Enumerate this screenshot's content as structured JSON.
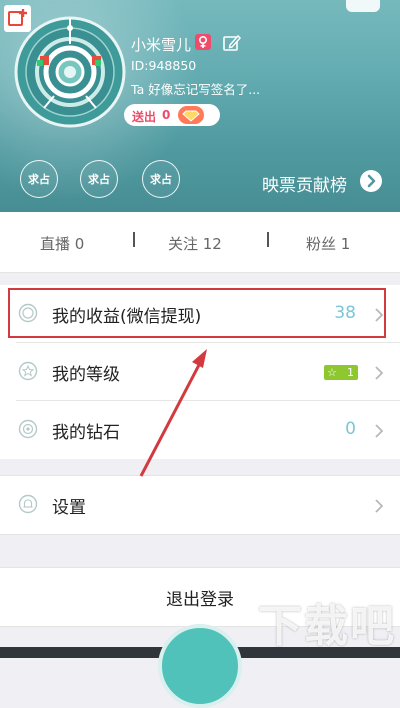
{
  "profile": {
    "username": "小米雪儿",
    "gender_symbol": "♀",
    "id_text": "ID:948850",
    "signature": "Ta 好像忘记写签名了...",
    "sent_label": "送出",
    "sent_count": "0"
  },
  "contrib": {
    "badges": [
      "求占",
      "求占",
      "求占"
    ],
    "label": "映票贡献榜"
  },
  "stats": {
    "live": "直播 0",
    "follow": "关注 12",
    "fans": "粉丝 1"
  },
  "menu": {
    "earnings": {
      "label": "我的收益(微信提现)",
      "value": "38"
    },
    "level": {
      "label": "我的等级",
      "star": "☆",
      "value": "1"
    },
    "diamonds": {
      "label": "我的钻石",
      "value": "0"
    },
    "settings": {
      "label": "设置"
    }
  },
  "logout": {
    "label": "退出登录"
  },
  "watermark": {
    "text": "下载吧"
  },
  "colors": {
    "header_teal": "#5aa7ac",
    "value_blue": "#7cc6d6",
    "highlight_red": "#d33a40",
    "level_green": "#8fc731",
    "accent_pink": "#ec4c6a"
  }
}
